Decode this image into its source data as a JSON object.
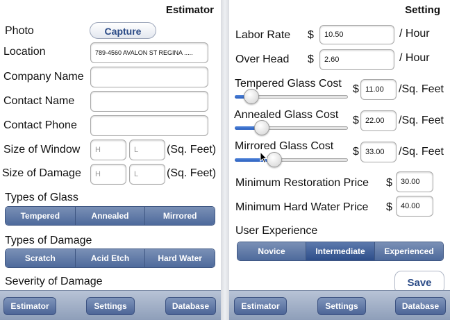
{
  "estimator": {
    "title": "Estimator",
    "photo_label": "Photo",
    "capture_label": "Capture",
    "location_label": "Location",
    "location_value": "789-4560 AVALON ST REGINA .....",
    "company_label": "Company Name",
    "contact_name_label": "Contact Name",
    "contact_phone_label": "Contact Phone",
    "window_label": "Size of Window",
    "damage_label": "Size of Damage",
    "h_placeholder": "H",
    "l_placeholder": "L",
    "unit": "(Sq. Feet)",
    "glass_types_label": "Types of Glass",
    "glass_types": [
      "Tempered",
      "Annealed",
      "Mirrored"
    ],
    "damage_types_label": "Types of Damage",
    "damage_types": [
      "Scratch",
      "Acid Etch",
      "Hard Water"
    ],
    "severity_label": "Severity of Damage",
    "toolbar": {
      "estimator": "Estimator",
      "settings": "Settings",
      "database": "Database"
    }
  },
  "setting": {
    "title": "Setting",
    "labor_label": "Labor Rate",
    "labor_value": "10.50",
    "overhead_label": "Over Head",
    "overhead_value": "2.60",
    "currency": "$",
    "per_hour": "/ Hour",
    "per_sqft": "/Sq. Feet",
    "tempered_label": "Tempered Glass Cost",
    "tempered_value": "11.00",
    "tempered_level": 0.15,
    "annealed_label": "Annealed Glass Cost",
    "annealed_value": "22.00",
    "annealed_level": 0.24,
    "mirrored_label": "Mirrored Glass Cost",
    "mirrored_value": "33.00",
    "mirrored_level": 0.35,
    "min_restoration_label": "Minimum Restoration Price",
    "min_restoration_value": "30.00",
    "min_hardwater_label": "Minimum Hard Water Price",
    "min_hardwater_value": "40.00",
    "ux_label": "User Experience",
    "ux_options": [
      "Novice",
      "Intermediate",
      "Experienced"
    ],
    "ux_selected": "Intermediate",
    "save_label": "Save",
    "toolbar": {
      "estimator": "Estimator",
      "settings": "Settings",
      "database": "Database"
    }
  },
  "colors": {
    "accent": "#4e6a9c",
    "slider_fill": "#2a5fbf",
    "link_text": "#2a4a86"
  }
}
